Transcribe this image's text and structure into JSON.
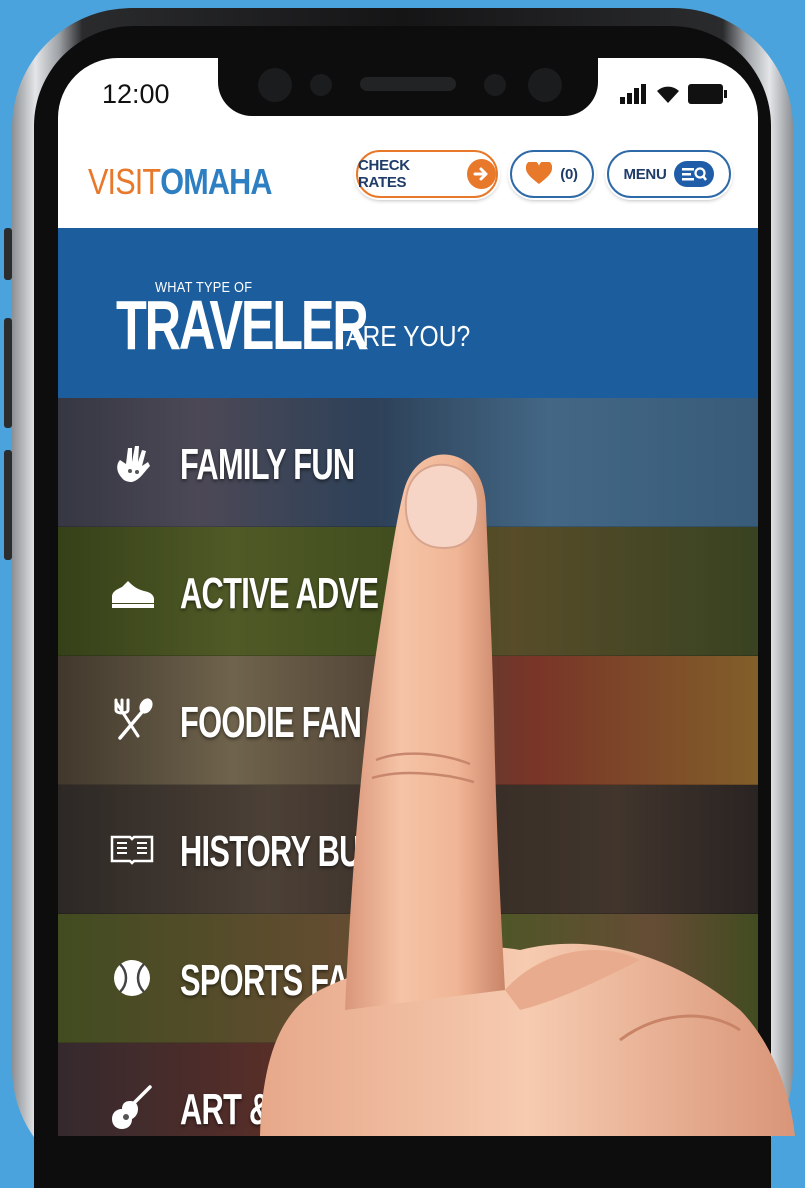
{
  "status_bar": {
    "time": "12:00"
  },
  "header": {
    "logo_visit": "VISIT",
    "logo_omaha": "OMAHA",
    "check_rates_label": "CHECK RATES",
    "favorites_count": "(0)",
    "menu_label": "MENU"
  },
  "banner": {
    "small": "WHAT TYPE OF",
    "big": "TRAVELER",
    "rest": "ARE YOU?"
  },
  "categories": [
    {
      "label": "FAMILY FUN",
      "icon": "hand-print-icon"
    },
    {
      "label": "ACTIVE ADVE",
      "icon": "sneaker-icon"
    },
    {
      "label": "FOODIE FAN",
      "icon": "fork-spoon-icon"
    },
    {
      "label": "HISTORY BU",
      "icon": "open-book-icon"
    },
    {
      "label": "SPORTS FAN",
      "icon": "baseball-icon"
    },
    {
      "label": "ART &",
      "icon": "guitar-icon"
    }
  ],
  "colors": {
    "brand_blue": "#1c5e9d",
    "brand_orange": "#e8782a",
    "background": "#4aa3dc"
  }
}
